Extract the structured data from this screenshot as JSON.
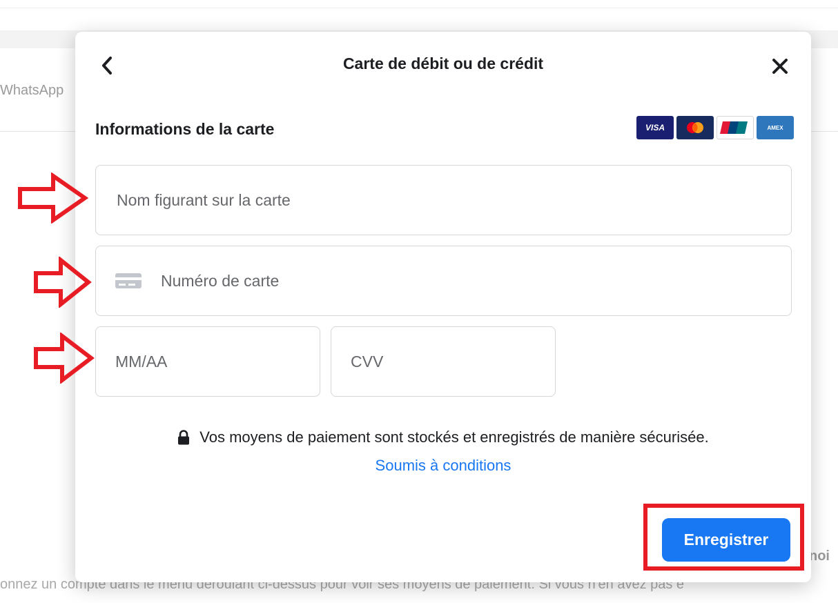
{
  "background": {
    "tab_partial": "WhatsApp",
    "right_partial": "noi",
    "bottom_partial": "onnez un compte dans le menu déroulant ci-dessus pour voir ses moyens de paiement. Si vous n'en avez pas e"
  },
  "modal": {
    "title": "Carte de débit ou de crédit",
    "back_icon": "chevron-left-icon",
    "close_icon": "close-icon",
    "section_title": "Informations de la carte",
    "card_logos": [
      "VISA",
      "Mastercard",
      "UnionPay",
      "AMEX"
    ],
    "fields": {
      "name_placeholder": "Nom figurant sur la carte",
      "number_placeholder": "Numéro de carte",
      "expiry_placeholder": "MM/AA",
      "cvv_placeholder": "CVV"
    },
    "secure_text": "Vos moyens de paiement sont stockés et enregistrés de manière sécurisée.",
    "terms_link": "Soumis à conditions",
    "save_label": "Enregistrer"
  },
  "colors": {
    "accent": "#1877f2",
    "annotation": "#e81c24",
    "text": "#1c1e21",
    "placeholder": "#65676b"
  }
}
